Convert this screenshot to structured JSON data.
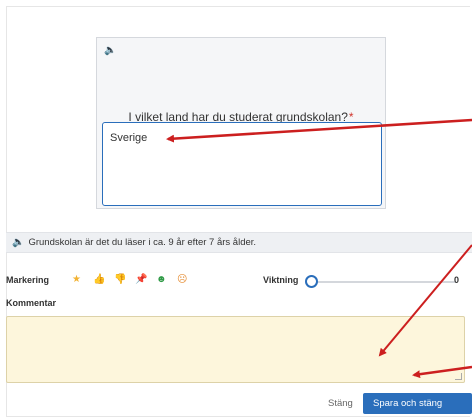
{
  "question": {
    "speaker_icon": "🔈",
    "text": "I vilket land har du studerat grundskolan?",
    "required_mark": "*",
    "answer_value": "Sverige"
  },
  "info": {
    "speaker_icon": "🔈",
    "text": "Grundskolan är det du läser i ca. 9 år efter 7 års ålder."
  },
  "marking": {
    "label": "Markering",
    "icons": [
      {
        "name": "star-icon",
        "glyph": "★",
        "color": "#f2b233"
      },
      {
        "name": "thumbs-up-icon",
        "glyph": "👍",
        "color": "#2a6ebb"
      },
      {
        "name": "thumbs-down-icon",
        "glyph": "👎",
        "color": "#2a6ebb"
      },
      {
        "name": "pin-icon",
        "glyph": "📌",
        "color": "#d0342c"
      },
      {
        "name": "happy-face-icon",
        "glyph": "☻",
        "color": "#2f9a46"
      },
      {
        "name": "sad-face-icon",
        "glyph": "☹",
        "color": "#e58a2e"
      }
    ]
  },
  "weighting": {
    "label": "Viktning",
    "value": "0",
    "level": 0
  },
  "comment": {
    "label": "Kommentar",
    "value": ""
  },
  "actions": {
    "close_label": "Stäng",
    "save_label": "Spara och stäng"
  },
  "colors": {
    "accent": "#2a6ebb",
    "annotation_arrow": "#cc1f1f",
    "comment_bg": "#fdf6dc"
  }
}
